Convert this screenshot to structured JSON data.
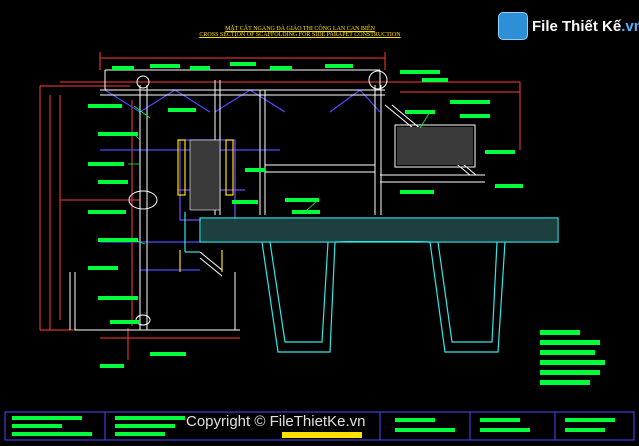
{
  "drawing": {
    "title_vi": "MẶT CẮT NGANG ĐÀ GIÁO THI CÔNG LAN CAN BIÊN",
    "title_en": "CROSS SECTION OF SCAFFOLDING FOR SIDE PARAPET CONSTRUCTION"
  },
  "logo": {
    "name": "File Thiết Kế",
    "suffix": ".vn"
  },
  "watermark": {
    "text": "Copyright © FileThietKe.vn"
  },
  "colors": {
    "background": "#000000",
    "structure": "#ffffff",
    "dimension": "#ff3b3b",
    "label": "#00ff3a",
    "concrete": "#34e6e6",
    "bracing": "#4a4aff",
    "frame": "#7a48ff",
    "highlight": "#ffe000"
  }
}
